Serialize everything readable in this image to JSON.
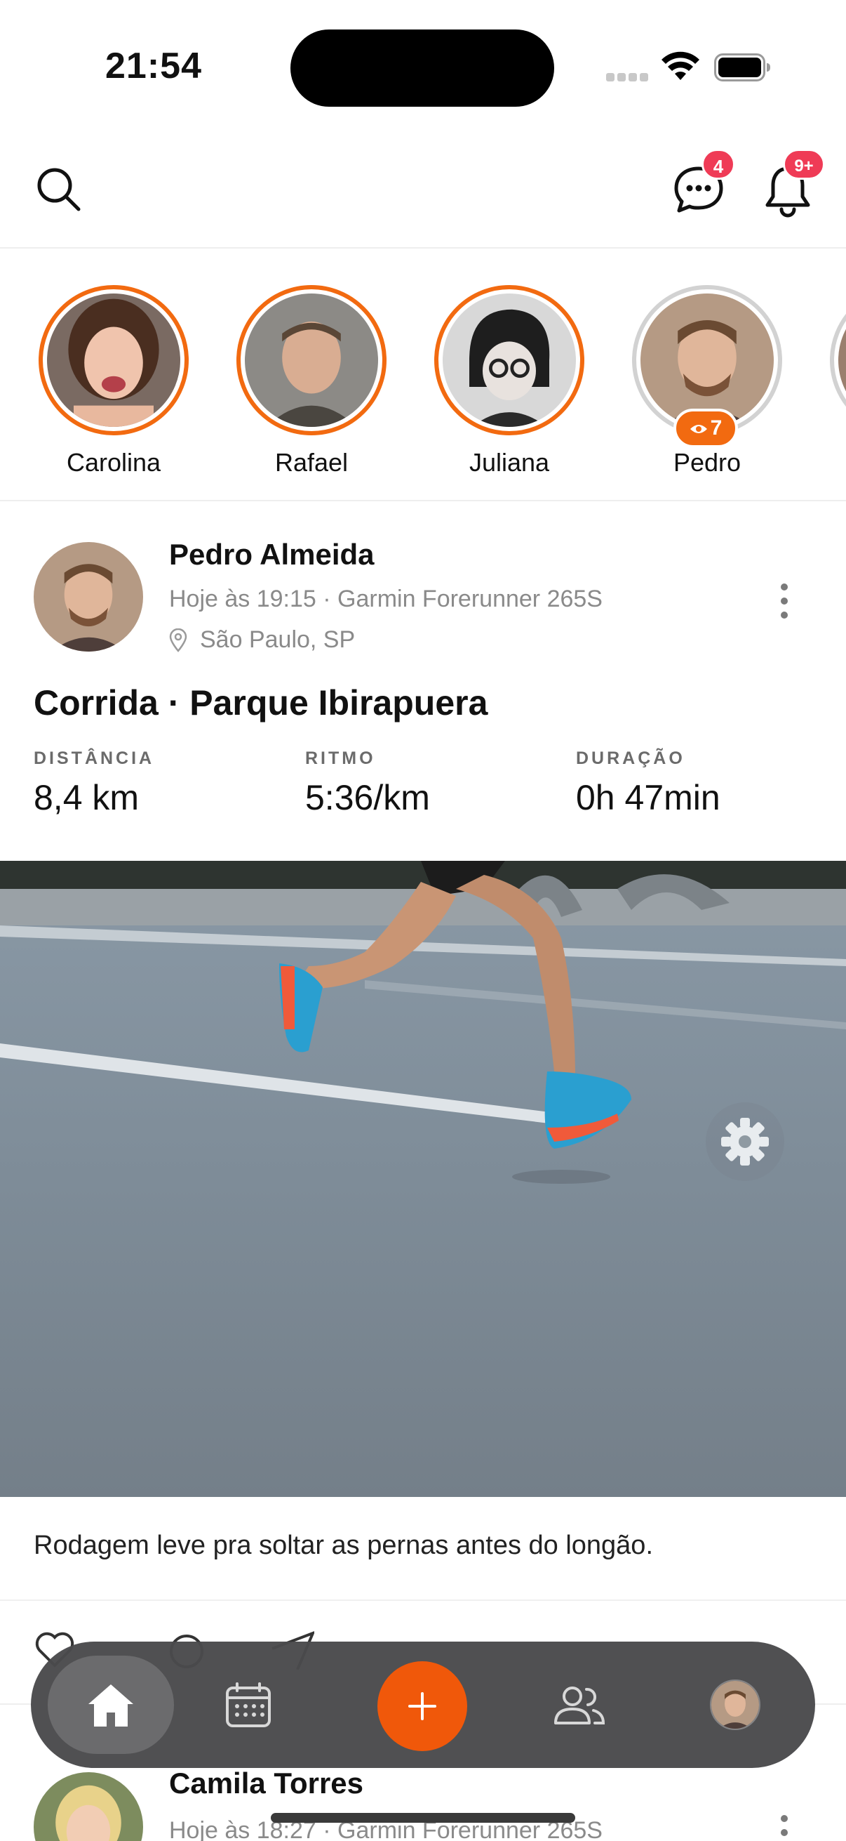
{
  "status_bar": {
    "time": "21:54"
  },
  "header": {
    "messages_badge": "4",
    "notifications_badge": "9+"
  },
  "stories": [
    {
      "name": "Carolina",
      "seen": false
    },
    {
      "name": "Rafael",
      "seen": false
    },
    {
      "name": "Juliana",
      "seen": false
    },
    {
      "name": "Pedro",
      "seen": true,
      "views": "7"
    }
  ],
  "post": {
    "author": "Pedro Almeida",
    "meta": "Hoje às 19:15 · Garmin Forerunner 265S",
    "location": "São Paulo, SP",
    "title": "Corrida · Parque Ibirapuera",
    "stats": [
      {
        "label": "DISTÂNCIA",
        "value": "8,4 km"
      },
      {
        "label": "RITMO",
        "value": "5:36/km"
      },
      {
        "label": "DURAÇÃO",
        "value": "0h 47min"
      }
    ],
    "caption": "Rodagem leve pra soltar as pernas antes do longão."
  },
  "next_post": {
    "author": "Camila Torres",
    "meta": "Hoje às 18:27 · Garmin Forerunner 265S"
  },
  "tab_bar": {
    "items": [
      "home-icon",
      "calendar-icon",
      "plus-icon",
      "people-icon",
      "avatar"
    ],
    "active": "home-icon"
  },
  "colors": {
    "accent": "#f26a10",
    "badge": "#ef3b56",
    "tabbar": "#4a4a4c"
  }
}
